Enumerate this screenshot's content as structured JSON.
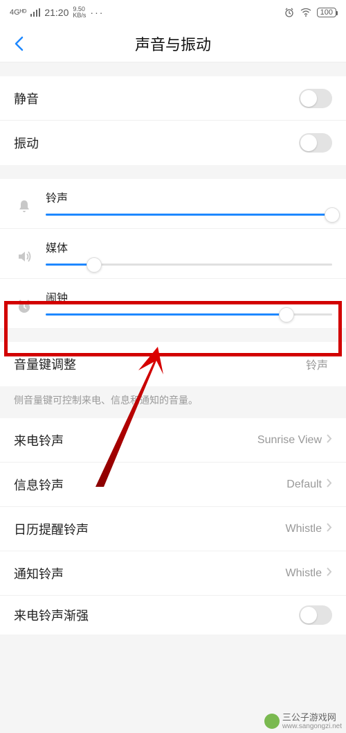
{
  "status_bar": {
    "network_type": "4Gᴴᴰ",
    "time": "21:20",
    "speed_top": "9.50",
    "speed_bottom": "KB/s",
    "dots": "···",
    "battery": "100"
  },
  "header": {
    "title": "声音与振动"
  },
  "toggles": {
    "mute_label": "静音",
    "vibrate_label": "振动"
  },
  "sliders": {
    "ringtone": {
      "label": "铃声",
      "percent": 100
    },
    "media": {
      "label": "媒体",
      "percent": 17
    },
    "alarm": {
      "label": "闹钟",
      "percent": 84
    }
  },
  "volume_key": {
    "label": "音量键调整",
    "value": "铃声",
    "desc": "侧音量键可控制来电、信息和通知的音量。"
  },
  "ringtones": {
    "incoming_label": "来电铃声",
    "incoming_value": "Sunrise View",
    "msg_label": "信息铃声",
    "msg_value": "Default",
    "calendar_label": "日历提醒铃声",
    "calendar_value": "Whistle",
    "notif_label": "通知铃声",
    "notif_value": "Whistle",
    "crescendo_label": "来电铃声渐强"
  },
  "watermark": {
    "text": "三公子游戏网",
    "url": "www.sangongzi.net"
  }
}
